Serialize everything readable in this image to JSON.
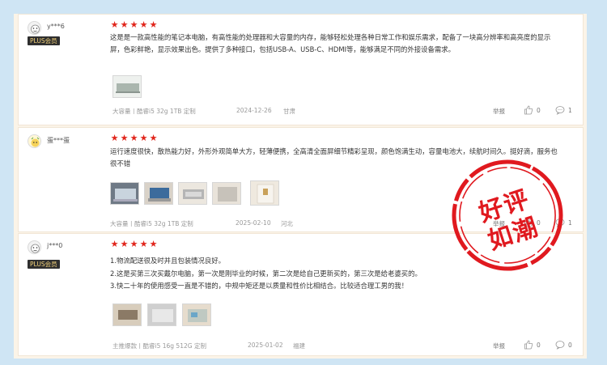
{
  "reviews": [
    {
      "user": "y***6",
      "badge": "PLUS会员",
      "text": "这是是一款高性能的笔记本电脑，有高性能的处理器和大容量的内存，能够轻松处理各种日常工作和娱乐需求，配备了一块高分辨率和高亮度的显示屏，色彩鲜艳，显示效果出色。提供了多种接口，包括USB-A、USB-C、HDMI等，能够满足不同的外接设备需求。",
      "spec": "大容量丨酷睿i5 32g 1TB 定制",
      "date": "2024-12-26",
      "location": "甘肃",
      "report": "举报",
      "likes": "0",
      "comments": "1",
      "stars": 5
    },
    {
      "user": "蛋***蛋",
      "badge": "",
      "text": "运行速度很快，散热能力好，外形外观简单大方，轻薄便携，全高清全面屏细节精彩呈现，颜色饱满生动，容量电池大，续航时间久。挺好滴，服务也很不错",
      "spec": "大容量丨酷睿i5 32g 1TB 定制",
      "date": "2025-02-10",
      "location": "河北",
      "report": "举报",
      "likes": "0",
      "comments": "1",
      "stars": 5
    },
    {
      "user": "j***0",
      "badge": "PLUS会员",
      "lines": [
        "1.物流配送很及时并且包装情况良好。",
        "2.这是买第三次买戴尔电脑，第一次是刚毕业的时候，第二次是给自己更新买的，第三次是给老婆买的。",
        "3.快二十年的使用感受一直是不错的，中规中矩还是以质量和性价比相结合。比较适合理工男的我！"
      ],
      "spec": "主推爆款丨酷睿i5 16g 512G 定制",
      "date": "2025-01-02",
      "location": "福建",
      "report": "举报",
      "likes": "0",
      "comments": "0",
      "stars": 5
    }
  ],
  "stamp": {
    "line1": "好评",
    "line2": "如潮"
  },
  "icons": {
    "like": "thumbs-up-icon",
    "comment": "comment-bubble-icon",
    "star": "star-icon",
    "avatar": "avatar-icon"
  },
  "colors": {
    "star": "#e1251b",
    "stamp": "#e0191f",
    "background": "#cfe5f4"
  }
}
